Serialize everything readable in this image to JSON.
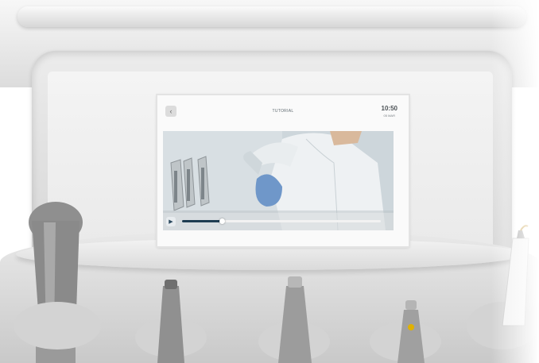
{
  "screen": {
    "title": "TUTORIAL",
    "clock": {
      "time": "10:50",
      "date": "05 MAR"
    },
    "back_icon": "chevron-left-icon",
    "video": {
      "play_icon": "play-icon",
      "progress": 0.2,
      "accent": "#1f3d52"
    }
  }
}
